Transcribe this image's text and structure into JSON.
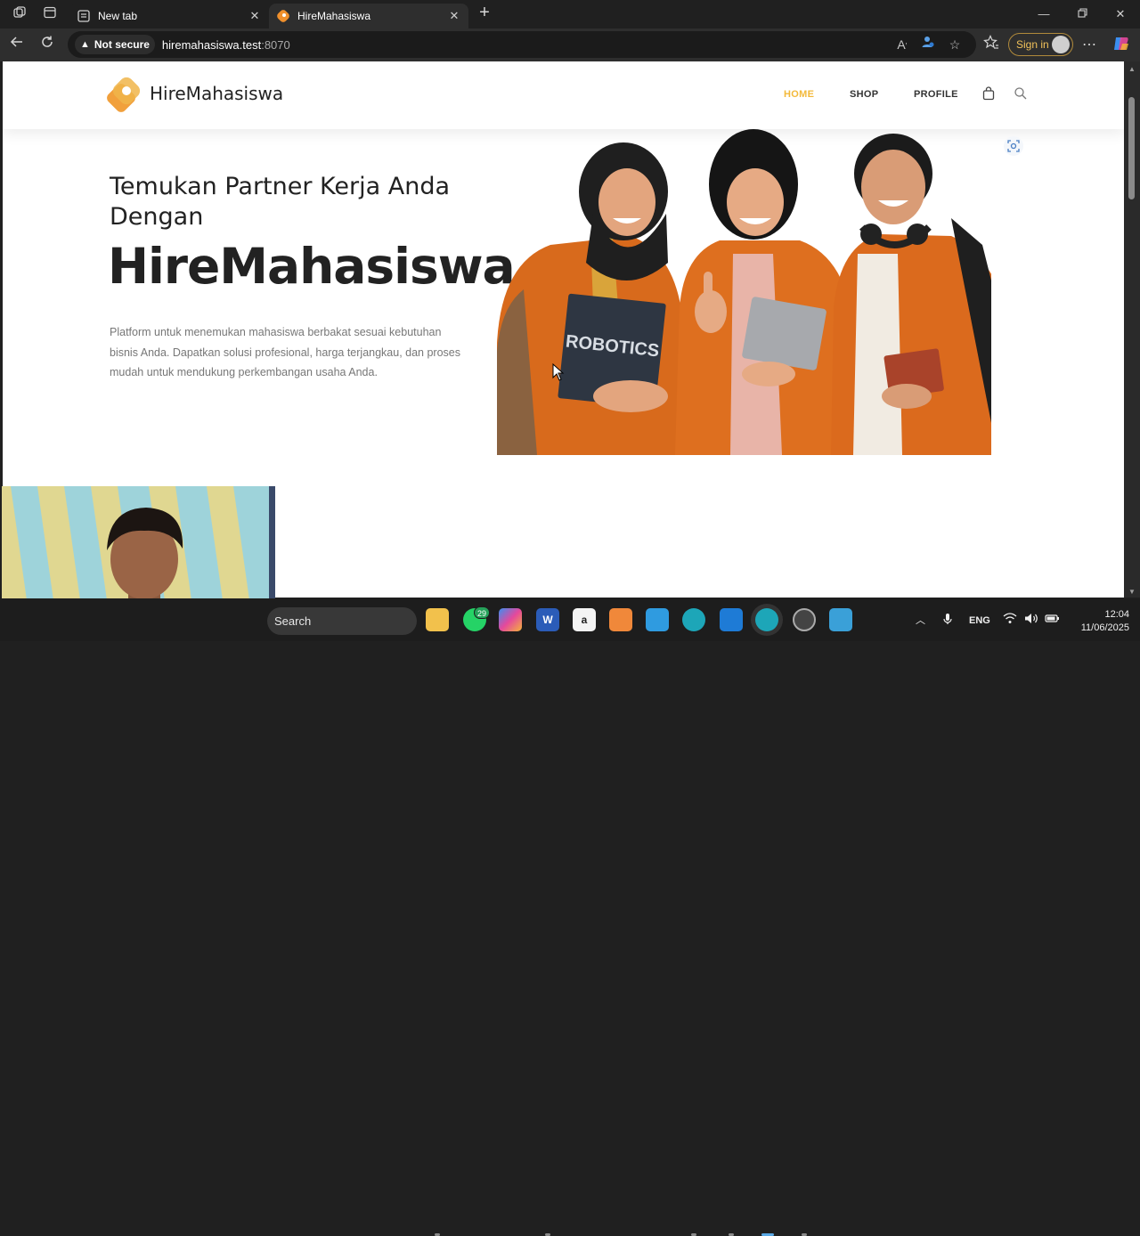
{
  "browser": {
    "tabs": [
      {
        "label": "New tab",
        "active": false
      },
      {
        "label": "HireMahasiswa",
        "active": true
      }
    ],
    "security_label": "Not secure",
    "url_host": "hiremahasiswa.test",
    "url_port": ":8070",
    "sign_in_label": "Sign in"
  },
  "site": {
    "brand": "HireMahasiswa",
    "nav": {
      "home": "HOME",
      "shop": "SHOP",
      "profile": "PROFILE"
    },
    "hero": {
      "subtitle": "Temukan Partner Kerja Anda Dengan",
      "title": "HireMahasiswa",
      "description": "Platform untuk menemukan mahasiswa berbakat sesuai kebutuhan bisnis Anda. Dapatkan solusi profesional, harga terjangkau, dan proses mudah untuk mendukung perkembangan usaha Anda.",
      "book_label": "ROBOTICS"
    },
    "accent_color": "#f3b93a"
  },
  "taskbar": {
    "search_placeholder": "Search",
    "whatsapp_badge": "29",
    "language": "ENG",
    "time": "12:04",
    "date": "11/06/2025"
  }
}
